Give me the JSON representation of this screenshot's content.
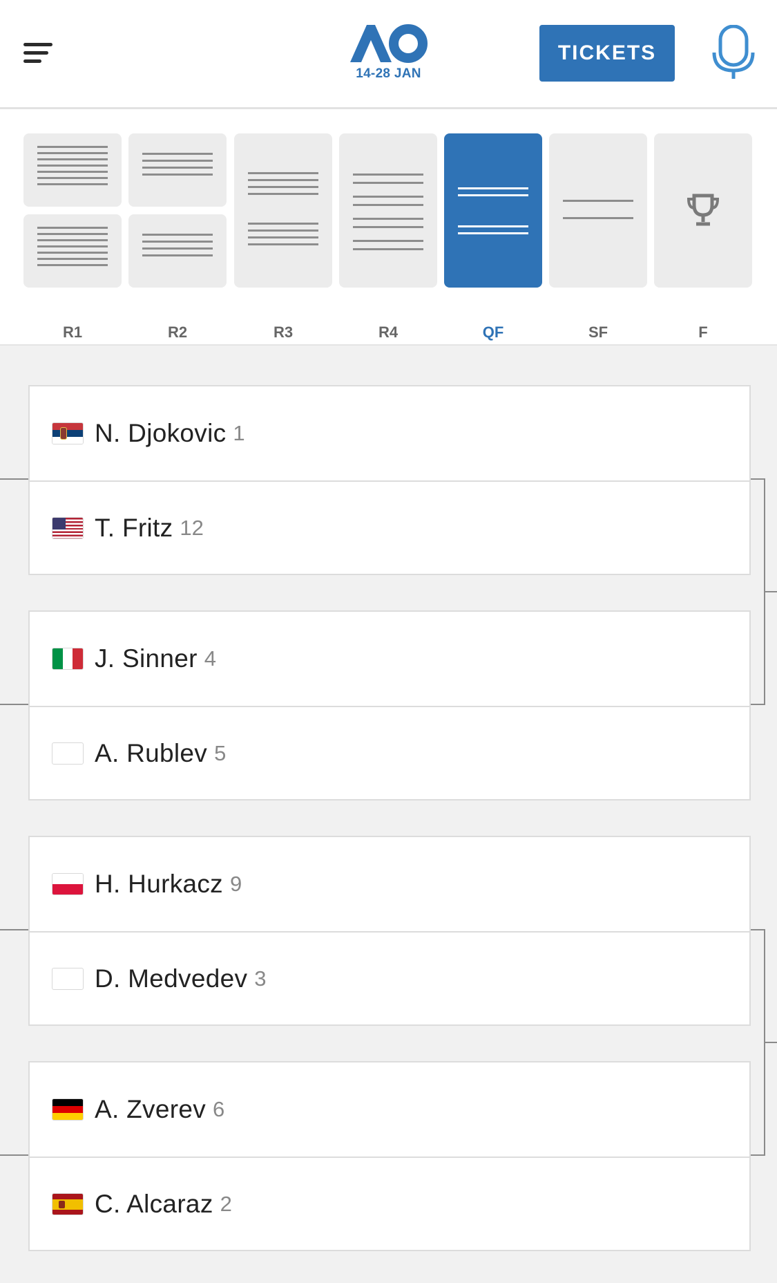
{
  "header": {
    "logo_date": "14-28 JAN",
    "tickets_label": "TICKETS"
  },
  "rounds": [
    {
      "label": "R1",
      "active": false
    },
    {
      "label": "R2",
      "active": false
    },
    {
      "label": "R3",
      "active": false
    },
    {
      "label": "R4",
      "active": false
    },
    {
      "label": "QF",
      "active": true
    },
    {
      "label": "SF",
      "active": false
    },
    {
      "label": "F",
      "active": false
    }
  ],
  "matches": [
    {
      "players": [
        {
          "name": "N. Djokovic",
          "seed": "1",
          "flag": "serbia"
        },
        {
          "name": "T. Fritz",
          "seed": "12",
          "flag": "usa"
        }
      ]
    },
    {
      "players": [
        {
          "name": "J. Sinner",
          "seed": "4",
          "flag": "italy"
        },
        {
          "name": "A. Rublev",
          "seed": "5",
          "flag": "none"
        }
      ]
    },
    {
      "players": [
        {
          "name": "H. Hurkacz",
          "seed": "9",
          "flag": "poland"
        },
        {
          "name": "D. Medvedev",
          "seed": "3",
          "flag": "none"
        }
      ]
    },
    {
      "players": [
        {
          "name": "A. Zverev",
          "seed": "6",
          "flag": "germany"
        },
        {
          "name": "C. Alcaraz",
          "seed": "2",
          "flag": "spain"
        }
      ]
    }
  ],
  "colors": {
    "accent": "#2f73b6",
    "tile": "#ececec"
  }
}
